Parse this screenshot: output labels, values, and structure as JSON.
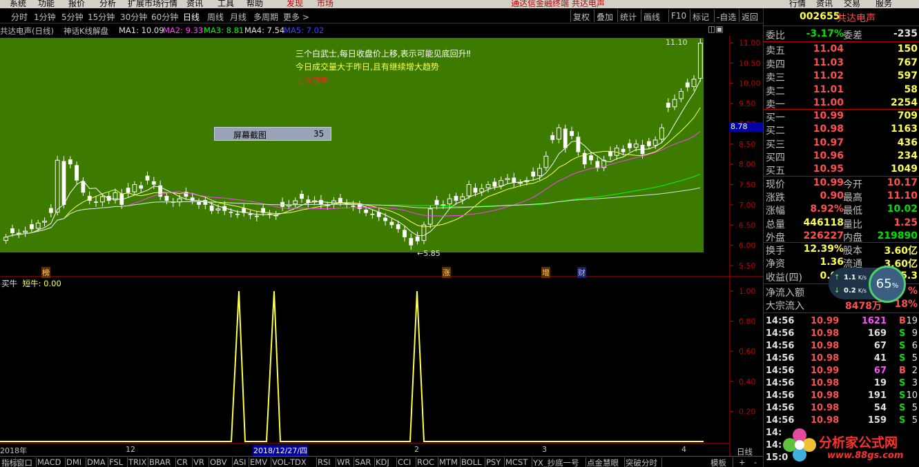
{
  "menu": [
    "系统",
    "功能",
    "报价",
    "分析",
    "扩展市场行情",
    "资讯",
    "工具",
    "帮助",
    "发现",
    "市场",
    "通达信金融终端  共达电声",
    "行情",
    "资讯",
    "交易",
    "服务"
  ],
  "toolbar": {
    "periods": [
      "分时",
      "1分钟",
      "5分钟",
      "15分钟",
      "30分钟",
      "60分钟",
      "日线",
      "周线",
      "月线",
      "多周期",
      "更多 >"
    ],
    "active_period": "日线",
    "right_buttons": [
      "复权",
      "叠加",
      "统计",
      "画线",
      "F10",
      "标记",
      "-自选",
      "返回"
    ]
  },
  "chart_info": {
    "stock": "共达电声(日线)",
    "indicator": "神话K线解盘",
    "ma1": "MA1: 10.09",
    "ma2": "MA2: 9.33",
    "ma3": "MA3: 8.81",
    "ma4": "MA4: 7.54",
    "ma5": "MA5: 7.02"
  },
  "annotations": {
    "line1": "三个白武士,每日收盘价上移,表示可能见底回升‼",
    "line2": "今日成交量大于昨日,且有继续增大趋势",
    "line3": "上涨趋势",
    "high_label": "11.10",
    "low_label": "5.85",
    "cursor_price": "8.78",
    "screenshot_box_label": "屏幕截图",
    "screenshot_box_value": "35"
  },
  "event_markers": [
    "榜",
    "涨",
    "增",
    "财"
  ],
  "indicator_pane": {
    "title": "买牛",
    "value": "短牛: 0.00"
  },
  "x_dates": [
    "2018年",
    "12",
    "2018/12/27/四",
    "2",
    "3",
    "4"
  ],
  "y_main": [
    "11.00",
    "10.50",
    "10.00",
    "9.50",
    "9.00",
    "8.50",
    "8.00",
    "7.50",
    "7.00",
    "6.50",
    "6.00",
    "5.50"
  ],
  "y_ind": [
    "1.00",
    "0.80",
    "0.60",
    "0.40",
    "0.20"
  ],
  "bottom_tabs": [
    "指标",
    "窗口",
    "MACD",
    "DMI",
    "DMA",
    "FSL",
    "TRIX",
    "BRAR",
    "CR",
    "VR",
    "OBV",
    "ASI",
    "EMV",
    "VOL-TDX",
    "RSI",
    "WR",
    "SAR",
    "KDJ",
    "CCI",
    "ROC",
    "MTM",
    "BOLL",
    "PSY",
    "MCST",
    "YX_抄底一号",
    "点金慧眼",
    "突破分时",
    "模板"
  ],
  "bottom_right": [
    "日线",
    "+",
    "-"
  ],
  "quote": {
    "code": "002655",
    "name": "共达电声",
    "weibi_label": "委比",
    "weibi": "-3.17%",
    "weicha_label": "委差",
    "weicha": "-235",
    "sell": [
      {
        "label": "卖五",
        "price": "11.04",
        "vol": "150"
      },
      {
        "label": "卖四",
        "price": "11.03",
        "vol": "767"
      },
      {
        "label": "卖三",
        "price": "11.02",
        "vol": "597"
      },
      {
        "label": "卖二",
        "price": "11.01",
        "vol": "58"
      },
      {
        "label": "卖一",
        "price": "11.00",
        "vol": "2254"
      }
    ],
    "buy": [
      {
        "label": "买一",
        "price": "10.99",
        "vol": "709"
      },
      {
        "label": "买二",
        "price": "10.98",
        "vol": "1163"
      },
      {
        "label": "买三",
        "price": "10.97",
        "vol": "436"
      },
      {
        "label": "买四",
        "price": "10.96",
        "vol": "234"
      },
      {
        "label": "买五",
        "price": "10.95",
        "vol": "1049"
      }
    ],
    "stats": [
      {
        "l1": "现价",
        "v1": "10.99",
        "l2": "今开",
        "v2": "10.17"
      },
      {
        "l1": "涨跌",
        "v1": "0.90",
        "l2": "最高",
        "v2": "11.10"
      },
      {
        "l1": "涨幅",
        "v1": "8.92%",
        "l2": "最低",
        "v2": "10.02"
      },
      {
        "l1": "总量",
        "v1": "446118",
        "l2": "量比",
        "v2": "1.25"
      },
      {
        "l1": "外盘",
        "v1": "226227",
        "l2": "内盘",
        "v2": "219890"
      }
    ],
    "stats2": [
      {
        "l1": "换手",
        "v1": "12.39%",
        "l2": "股本",
        "v2": "3.60亿"
      },
      {
        "l1": "净资",
        "v1": "1.36",
        "l2": "流通",
        "v2": "3.60亿"
      },
      {
        "l1": "收益(四)",
        "v1": "0.05",
        "l2": "",
        "v2": "5.3"
      }
    ],
    "flow": [
      {
        "l1": "净流入额",
        "v2": "%"
      },
      {
        "l1": "大宗流入",
        "v1": "8478万",
        "v2": "18%"
      }
    ],
    "ticks": [
      {
        "t": "14:56",
        "p": "10.99",
        "v": "1621",
        "s": "B",
        "n": "19"
      },
      {
        "t": "14:56",
        "p": "10.98",
        "v": "169",
        "s": "S",
        "n": "9"
      },
      {
        "t": "14:56",
        "p": "10.98",
        "v": "67",
        "s": "S",
        "n": "6"
      },
      {
        "t": "14:56",
        "p": "10.98",
        "v": "41",
        "s": "S",
        "n": "5"
      },
      {
        "t": "14:56",
        "p": "10.99",
        "v": "67",
        "s": "B",
        "n": "2"
      },
      {
        "t": "14:56",
        "p": "10.98",
        "v": "19",
        "s": "S",
        "n": "3"
      },
      {
        "t": "14:56",
        "p": "10.98",
        "v": "191",
        "s": "S",
        "n": "10"
      },
      {
        "t": "14:56",
        "p": "10.98",
        "v": "54",
        "s": "S",
        "n": "5"
      },
      {
        "t": "14:56",
        "p": "10.98",
        "v": "159",
        "s": "S",
        "n": "5"
      },
      {
        "t": "14:",
        "p": "",
        "v": "",
        "s": "",
        "n": ""
      },
      {
        "t": "14:",
        "p": "",
        "v": "",
        "s": "",
        "n": ""
      },
      {
        "t": "15:0",
        "p": "",
        "v": "",
        "s": "",
        "n": ""
      }
    ]
  },
  "net": {
    "up": "1.1",
    "up_unit": "K/s",
    "down": "0.2",
    "down_unit": "K/s",
    "gauge": "65",
    "gauge_unit": "%"
  },
  "watermark": {
    "title": "分析家公式网",
    "url": "www.88gs.com"
  },
  "colors": {
    "chart_bg": "#3c7a00",
    "up": "#ffffff",
    "down": "#ffffff",
    "ma1": "#ffffff",
    "ma2": "#ffff00",
    "ma3": "#ff40ff",
    "ma4": "#00ff00",
    "ma5": "#ffffff",
    "signal": "#ffff50"
  }
}
